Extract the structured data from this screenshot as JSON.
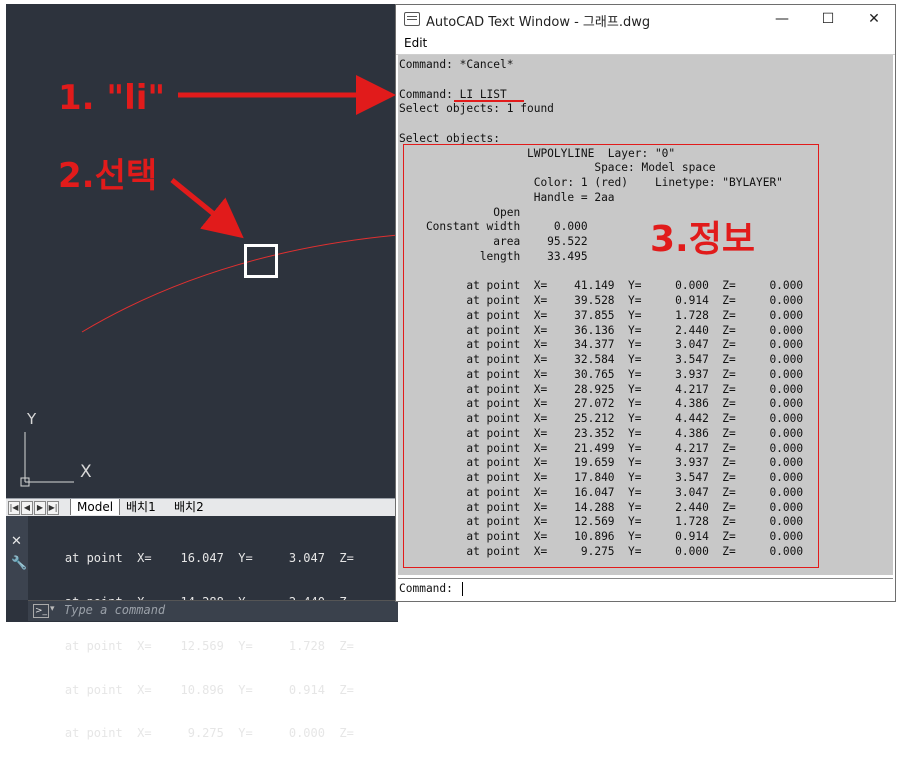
{
  "canvas": {
    "layout_tabs": [
      "Model",
      "배치1",
      "배치2"
    ],
    "active_tab": "Model",
    "ucs": {
      "y_label": "Y",
      "x_label": "X"
    },
    "curve_color": "#e03030",
    "background": "#2d333d"
  },
  "command_area": {
    "history": [
      "    at point  X=    16.047  Y=     3.047  Z=",
      "    at point  X=    14.288  Y=     2.440  Z=",
      "    at point  X=    12.569  Y=     1.728  Z=",
      "    at point  X=    10.896  Y=     0.914  Z=",
      "    at point  X=     9.275  Y=     0.000  Z="
    ],
    "close_icon": "close-icon",
    "customize_icon": "wrench-icon",
    "input_placeholder": "Type a command",
    "prompt_icon": "command-prompt-icon"
  },
  "text_window": {
    "title": "AutoCAD Text Window - 그래프.dwg",
    "menu": [
      "Edit"
    ],
    "controls": {
      "minimize": "—",
      "maximize": "☐",
      "close": "✕"
    },
    "lines": [
      "Command: *Cancel*",
      "",
      "Command: LI LIST",
      "Select objects: 1 found",
      "",
      "Select objects:",
      "                   LWPOLYLINE  Layer: \"0\"",
      "                             Space: Model space",
      "                    Color: 1 (red)    Linetype: \"BYLAYER\"",
      "                    Handle = 2aa",
      "              Open",
      "    Constant width     0.000",
      "              area    95.522",
      "            length    33.495",
      "",
      "          at point  X=    41.149  Y=     0.000  Z=     0.000",
      "          at point  X=    39.528  Y=     0.914  Z=     0.000",
      "          at point  X=    37.855  Y=     1.728  Z=     0.000",
      "          at point  X=    36.136  Y=     2.440  Z=     0.000",
      "          at point  X=    34.377  Y=     3.047  Z=     0.000",
      "          at point  X=    32.584  Y=     3.547  Z=     0.000",
      "          at point  X=    30.765  Y=     3.937  Z=     0.000",
      "          at point  X=    28.925  Y=     4.217  Z=     0.000",
      "          at point  X=    27.072  Y=     4.386  Z=     0.000",
      "          at point  X=    25.212  Y=     4.442  Z=     0.000",
      "          at point  X=    23.352  Y=     4.386  Z=     0.000",
      "          at point  X=    21.499  Y=     4.217  Z=     0.000",
      "          at point  X=    19.659  Y=     3.937  Z=     0.000",
      "          at point  X=    17.840  Y=     3.547  Z=     0.000",
      "          at point  X=    16.047  Y=     3.047  Z=     0.000",
      "          at point  X=    14.288  Y=     2.440  Z=     0.000",
      "          at point  X=    12.569  Y=     1.728  Z=     0.000",
      "          at point  X=    10.896  Y=     0.914  Z=     0.000",
      "          at point  X=     9.275  Y=     0.000  Z=     0.000"
    ],
    "command_prompt": "Command: "
  },
  "annotations": {
    "step1": "1. \"li\"",
    "step2": "2.선택",
    "step3": "3.정보",
    "color": "#e11b1b"
  }
}
